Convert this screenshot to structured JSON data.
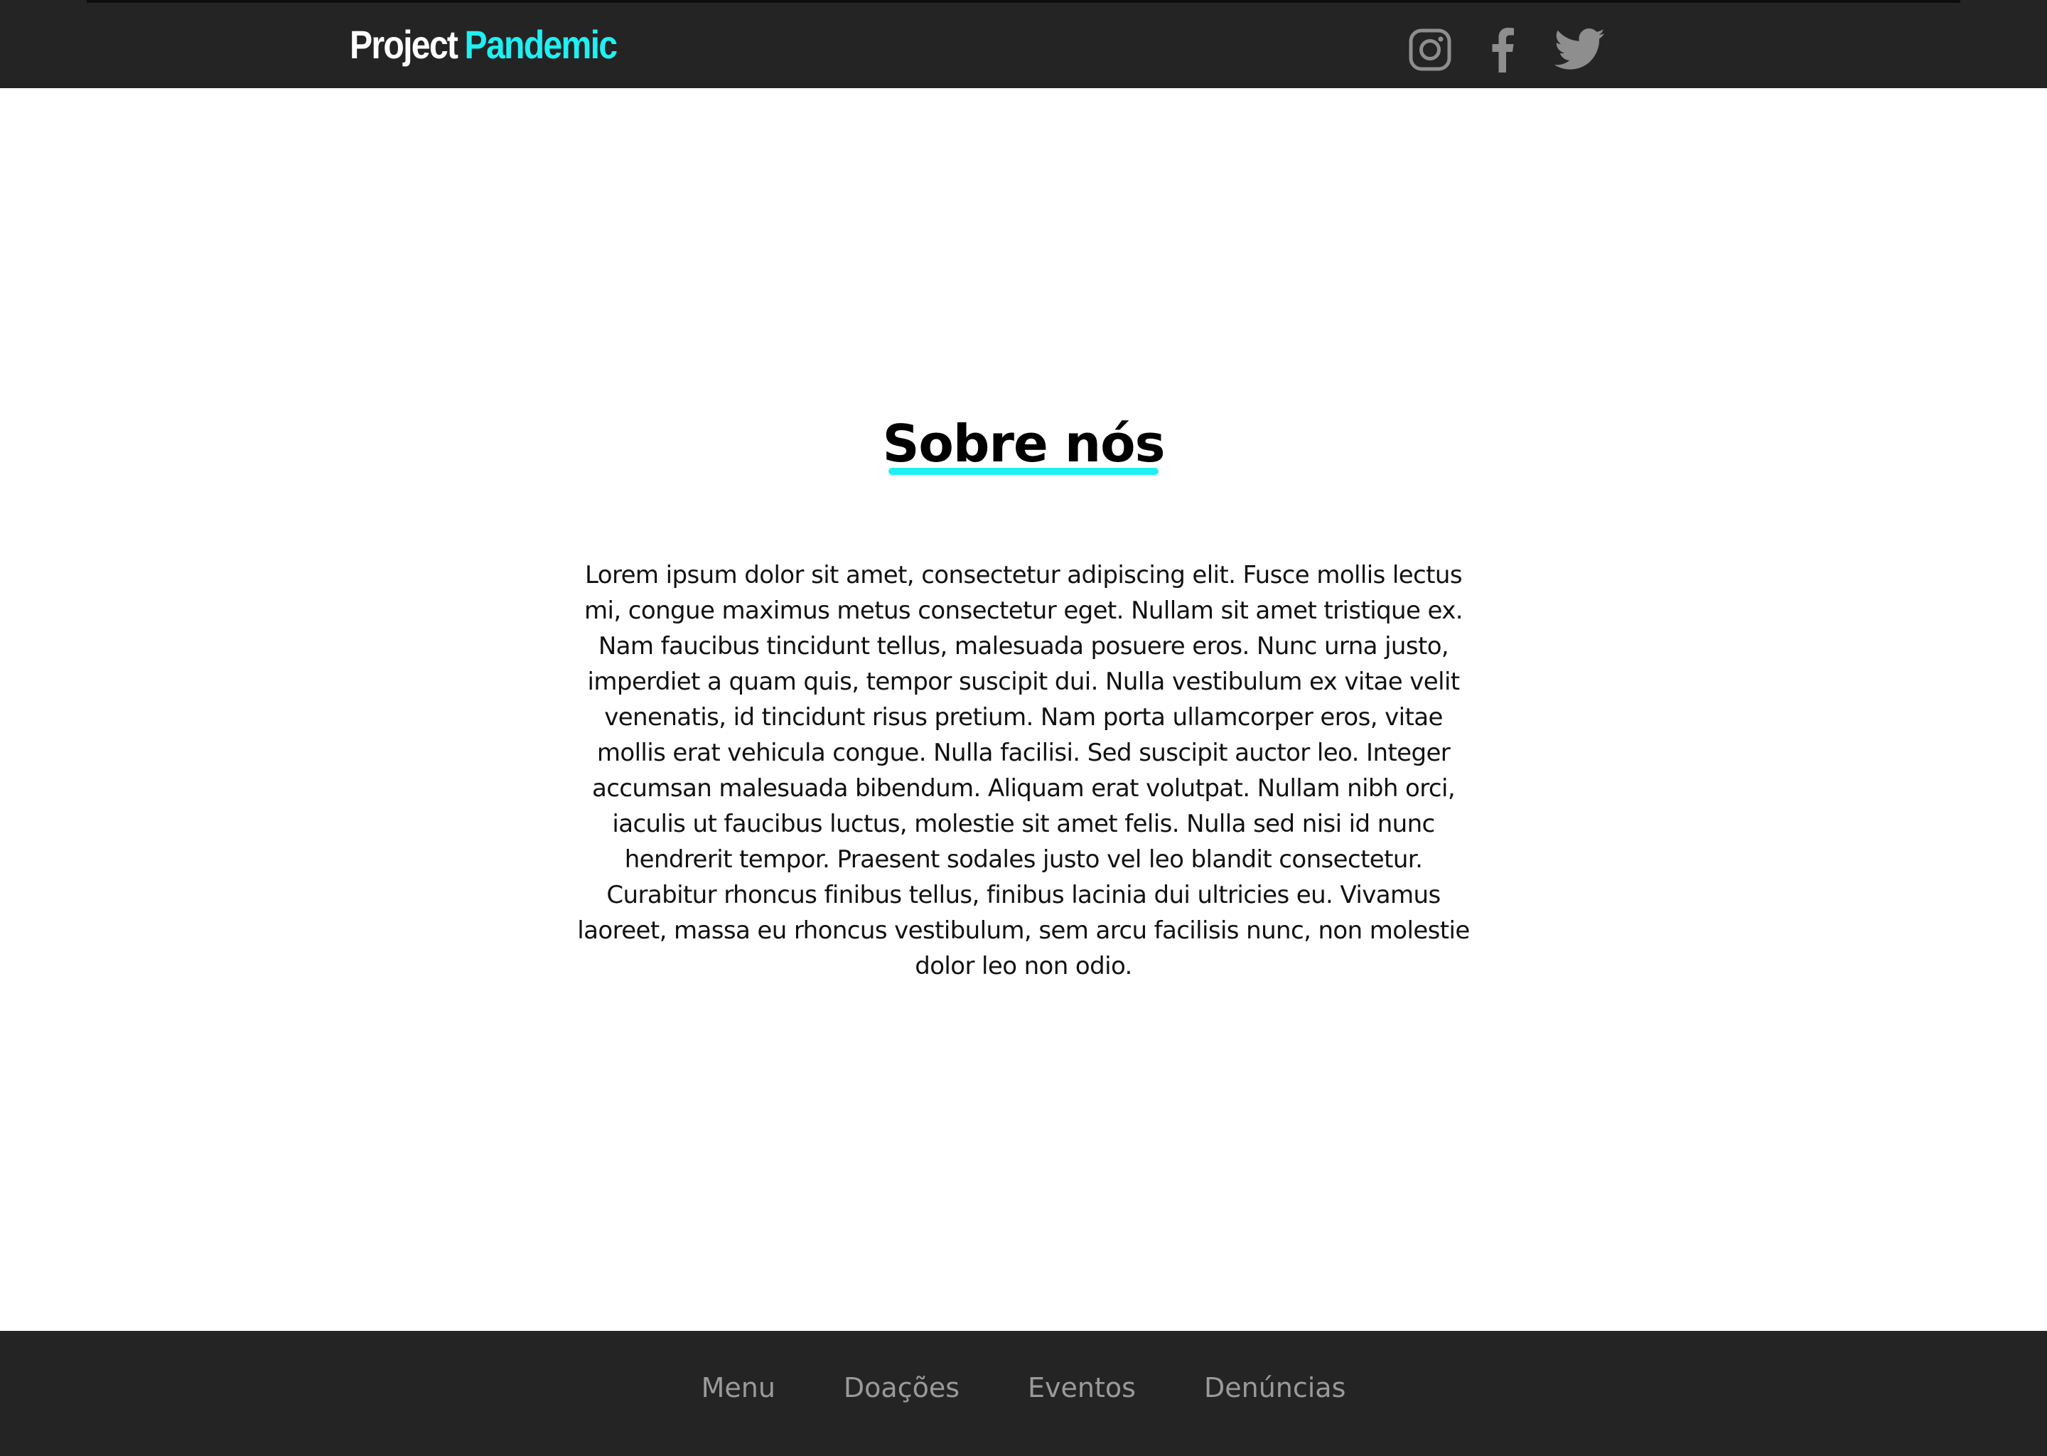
{
  "header": {
    "logo": {
      "part1": "Project",
      "part2": "Pandemic"
    },
    "social": [
      {
        "name": "instagram",
        "icon": "instagram-icon"
      },
      {
        "name": "facebook",
        "icon": "facebook-icon"
      },
      {
        "name": "twitter",
        "icon": "twitter-icon"
      }
    ]
  },
  "main": {
    "title": "Sobre nós",
    "paragraph": "Lorem ipsum dolor sit amet, consectetur adipiscing elit. Fusce mollis lectus mi, congue maximus metus consectetur eget. Nullam sit amet tristique ex. Nam faucibus tincidunt tellus, malesuada posuere eros. Nunc urna justo, imperdiet a quam quis, tempor suscipit dui. Nulla vestibulum ex vitae velit venenatis, id tincidunt risus pretium. Nam porta ullamcorper eros, vitae mollis erat vehicula congue. Nulla facilisi. Sed suscipit auctor leo. Integer accumsan malesuada bibendum. Aliquam erat volutpat. Nullam nibh orci, iaculis ut faucibus luctus, molestie sit amet felis. Nulla sed nisi id nunc hendrerit tempor. Praesent sodales justo vel leo blandit consectetur. Curabitur rhoncus finibus tellus, finibus lacinia dui ultricies eu. Vivamus laoreet, massa eu rhoncus vestibulum, sem arcu facilisis nunc, non molestie dolor leo non odio."
  },
  "footer": {
    "links": [
      {
        "label": "Menu"
      },
      {
        "label": "Doações"
      },
      {
        "label": "Eventos"
      },
      {
        "label": "Denúncias"
      }
    ]
  },
  "colors": {
    "header_bg": "#252425",
    "accent": "#1ff0f2",
    "footer_link": "#9a9a9a",
    "icon": "#8e8e8e"
  }
}
